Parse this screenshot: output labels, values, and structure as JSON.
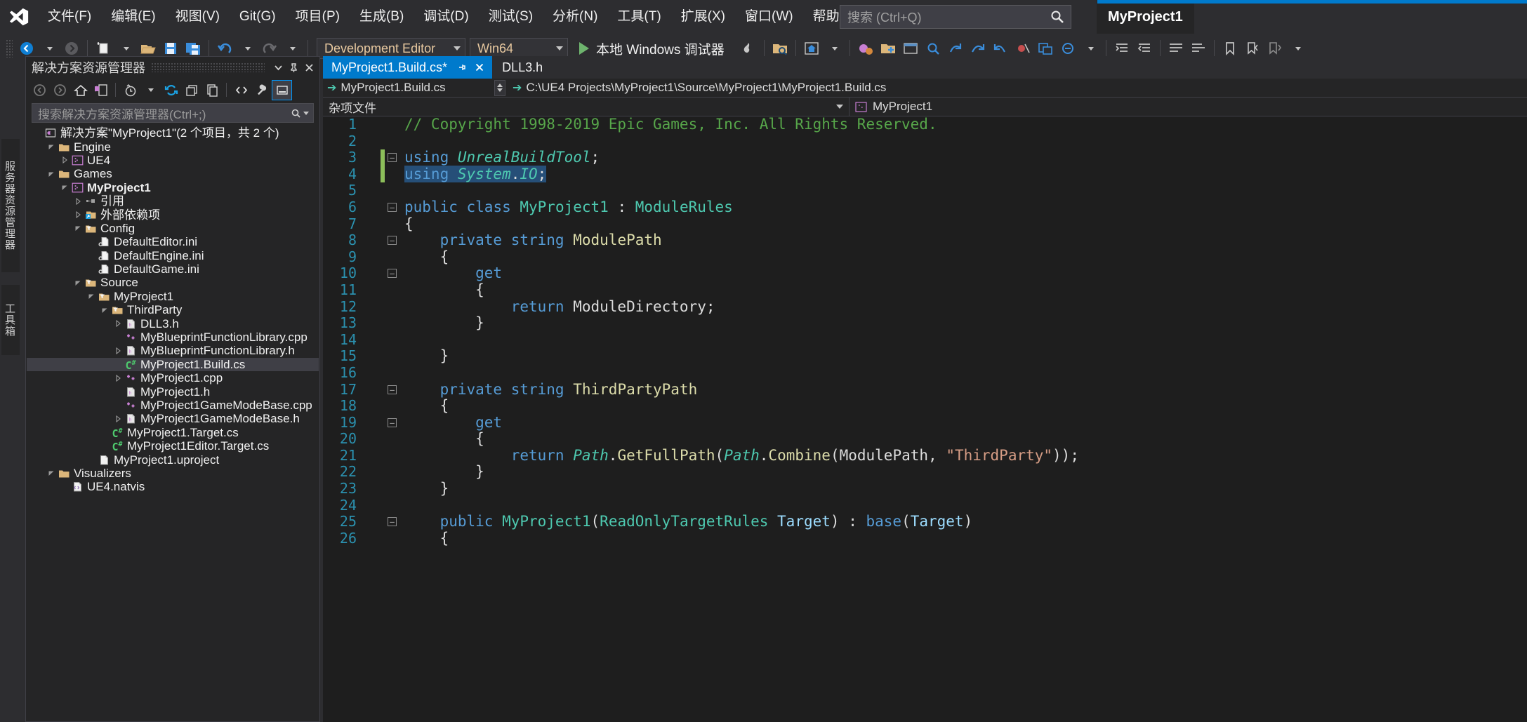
{
  "app": {
    "project_name": "MyProject1",
    "accent_color": "#007acc"
  },
  "menu": {
    "items": [
      {
        "label": "文件(F)"
      },
      {
        "label": "编辑(E)"
      },
      {
        "label": "视图(V)"
      },
      {
        "label": "Git(G)"
      },
      {
        "label": "项目(P)"
      },
      {
        "label": "生成(B)"
      },
      {
        "label": "调试(D)"
      },
      {
        "label": "测试(S)"
      },
      {
        "label": "分析(N)"
      },
      {
        "label": "工具(T)"
      },
      {
        "label": "扩展(X)"
      },
      {
        "label": "窗口(W)"
      },
      {
        "label": "帮助(H)"
      }
    ]
  },
  "search": {
    "placeholder": "搜索 (Ctrl+Q)",
    "icon": "search-icon"
  },
  "toolbar": {
    "configuration": "Development Editor",
    "platform": "Win64",
    "run_label": "本地 Windows 调试器"
  },
  "left_strip": {
    "tabs": [
      {
        "label": "服务器资源管理器"
      },
      {
        "label": "工具箱"
      }
    ]
  },
  "solution_explorer": {
    "title": "解决方案资源管理器",
    "search_placeholder": "搜索解决方案资源管理器(Ctrl+;)",
    "toolbar_icons": [
      "back-icon",
      "forward-icon",
      "home-icon",
      "pending-changes-icon",
      "history-icon",
      "refresh-icon",
      "collapse-all-icon",
      "show-all-files-icon",
      "view-code-icon",
      "properties-icon",
      "preview-selected-icon"
    ],
    "header_icons": [
      "chevron-down-icon",
      "pin-icon",
      "close-icon"
    ],
    "tree": [
      {
        "label": "解决方案\"MyProject1\"(2 个项目，共 2 个)",
        "depth": 0,
        "icon": "solution-icon",
        "chev": "none",
        "bold": false,
        "selected": false
      },
      {
        "label": "Engine",
        "depth": 1,
        "icon": "folder-icon",
        "chev": "expanded",
        "bold": false,
        "selected": false
      },
      {
        "label": "UE4",
        "depth": 2,
        "icon": "cpp-project-icon",
        "chev": "collapsed",
        "bold": false,
        "selected": false
      },
      {
        "label": "Games",
        "depth": 1,
        "icon": "folder-icon",
        "chev": "expanded",
        "bold": false,
        "selected": false
      },
      {
        "label": "MyProject1",
        "depth": 2,
        "icon": "cpp-project-icon",
        "chev": "expanded",
        "bold": true,
        "selected": false
      },
      {
        "label": "引用",
        "depth": 3,
        "icon": "references-icon",
        "chev": "collapsed",
        "bold": false,
        "selected": false
      },
      {
        "label": "外部依赖项",
        "depth": 3,
        "icon": "external-deps-icon",
        "chev": "collapsed",
        "bold": false,
        "selected": false
      },
      {
        "label": "Config",
        "depth": 3,
        "icon": "filter-folder-icon",
        "chev": "expanded",
        "bold": false,
        "selected": false
      },
      {
        "label": "DefaultEditor.ini",
        "depth": 4,
        "icon": "ini-file-icon",
        "chev": "none",
        "bold": false,
        "selected": false
      },
      {
        "label": "DefaultEngine.ini",
        "depth": 4,
        "icon": "ini-file-icon",
        "chev": "none",
        "bold": false,
        "selected": false
      },
      {
        "label": "DefaultGame.ini",
        "depth": 4,
        "icon": "ini-file-icon",
        "chev": "none",
        "bold": false,
        "selected": false
      },
      {
        "label": "Source",
        "depth": 3,
        "icon": "filter-folder-icon",
        "chev": "expanded",
        "bold": false,
        "selected": false
      },
      {
        "label": "MyProject1",
        "depth": 4,
        "icon": "filter-folder-icon",
        "chev": "expanded",
        "bold": false,
        "selected": false
      },
      {
        "label": "ThirdParty",
        "depth": 5,
        "icon": "filter-folder-icon",
        "chev": "expanded",
        "bold": false,
        "selected": false
      },
      {
        "label": "DLL3.h",
        "depth": 6,
        "icon": "header-file-icon",
        "chev": "collapsed",
        "bold": false,
        "selected": false
      },
      {
        "label": "MyBlueprintFunctionLibrary.cpp",
        "depth": 6,
        "icon": "cpp-file-icon",
        "chev": "none",
        "bold": false,
        "selected": false
      },
      {
        "label": "MyBlueprintFunctionLibrary.h",
        "depth": 6,
        "icon": "header-file-icon",
        "chev": "collapsed",
        "bold": false,
        "selected": false
      },
      {
        "label": "MyProject1.Build.cs",
        "depth": 6,
        "icon": "csharp-file-icon",
        "chev": "none",
        "bold": false,
        "selected": true
      },
      {
        "label": "MyProject1.cpp",
        "depth": 6,
        "icon": "cpp-file-icon",
        "chev": "collapsed",
        "bold": false,
        "selected": false
      },
      {
        "label": "MyProject1.h",
        "depth": 6,
        "icon": "header-file-icon",
        "chev": "none",
        "bold": false,
        "selected": false
      },
      {
        "label": "MyProject1GameModeBase.cpp",
        "depth": 6,
        "icon": "cpp-file-icon",
        "chev": "none",
        "bold": false,
        "selected": false
      },
      {
        "label": "MyProject1GameModeBase.h",
        "depth": 6,
        "icon": "header-file-icon",
        "chev": "collapsed",
        "bold": false,
        "selected": false
      },
      {
        "label": "MyProject1.Target.cs",
        "depth": 5,
        "icon": "csharp-file-icon",
        "chev": "none",
        "bold": false,
        "selected": false
      },
      {
        "label": "MyProject1Editor.Target.cs",
        "depth": 5,
        "icon": "csharp-file-icon",
        "chev": "none",
        "bold": false,
        "selected": false
      },
      {
        "label": "MyProject1.uproject",
        "depth": 4,
        "icon": "generic-file-icon",
        "chev": "none",
        "bold": false,
        "selected": false
      },
      {
        "label": "Visualizers",
        "depth": 1,
        "icon": "folder-icon",
        "chev": "expanded",
        "bold": false,
        "selected": false
      },
      {
        "label": "UE4.natvis",
        "depth": 2,
        "icon": "natvis-file-icon",
        "chev": "none",
        "bold": false,
        "selected": false
      }
    ]
  },
  "editor": {
    "tabs": [
      {
        "label": "MyProject1.Build.cs*",
        "active": true,
        "closable": true
      },
      {
        "label": "DLL3.h",
        "active": false,
        "closable": false
      }
    ],
    "nav_left": "MyProject1.Build.cs",
    "nav_right": "C:\\UE4 Projects\\MyProject1\\Source\\MyProject1\\MyProject1.Build.cs",
    "crumb_left": "杂项文件",
    "crumb_right": "MyProject1",
    "first_line_number": 1,
    "lines": [
      {
        "n": 1,
        "fold": "none",
        "change": false,
        "tokens": [
          {
            "t": "// Copyright 1998-2019 Epic Games, Inc. All Rights Reserved.",
            "c": "c-com"
          }
        ]
      },
      {
        "n": 2,
        "fold": "none",
        "change": false,
        "tokens": []
      },
      {
        "n": 3,
        "fold": "minus",
        "change": true,
        "tokens": [
          {
            "t": "using ",
            "c": "c-kw"
          },
          {
            "t": "UnrealBuildTool",
            "c": "c-ns"
          },
          {
            "t": ";",
            "c": "c-pln"
          }
        ]
      },
      {
        "n": 4,
        "fold": "none",
        "change": true,
        "tokens": [
          {
            "t": "using ",
            "c": "c-kw c-sel"
          },
          {
            "t": "System",
            "c": "c-ns c-sel"
          },
          {
            "t": ".",
            "c": "c-pln c-sel"
          },
          {
            "t": "IO",
            "c": "c-ns c-sel"
          },
          {
            "t": ";",
            "c": "c-pln c-sel"
          }
        ]
      },
      {
        "n": 5,
        "fold": "none",
        "change": false,
        "tokens": []
      },
      {
        "n": 6,
        "fold": "minus",
        "change": false,
        "tokens": [
          {
            "t": "public ",
            "c": "c-kw"
          },
          {
            "t": "class ",
            "c": "c-kw"
          },
          {
            "t": "MyProject1",
            "c": "c-typ"
          },
          {
            "t": " : ",
            "c": "c-pln"
          },
          {
            "t": "ModuleRules",
            "c": "c-typ"
          }
        ]
      },
      {
        "n": 7,
        "fold": "none",
        "change": false,
        "tokens": [
          {
            "t": "{",
            "c": "c-pln"
          }
        ]
      },
      {
        "n": 8,
        "fold": "minus",
        "change": false,
        "tokens": [
          {
            "t": "    private ",
            "c": "c-kw"
          },
          {
            "t": "string ",
            "c": "c-kw"
          },
          {
            "t": "ModulePath",
            "c": "c-mem"
          }
        ]
      },
      {
        "n": 9,
        "fold": "none",
        "change": false,
        "tokens": [
          {
            "t": "    {",
            "c": "c-pln"
          }
        ]
      },
      {
        "n": 10,
        "fold": "minus",
        "change": false,
        "tokens": [
          {
            "t": "        get",
            "c": "c-kw"
          }
        ]
      },
      {
        "n": 11,
        "fold": "none",
        "change": false,
        "tokens": [
          {
            "t": "        {",
            "c": "c-pln"
          }
        ]
      },
      {
        "n": 12,
        "fold": "none",
        "change": false,
        "tokens": [
          {
            "t": "            return ",
            "c": "c-kw"
          },
          {
            "t": "ModuleDirectory",
            "c": "c-pln"
          },
          {
            "t": ";",
            "c": "c-pln"
          }
        ]
      },
      {
        "n": 13,
        "fold": "none",
        "change": false,
        "tokens": [
          {
            "t": "        }",
            "c": "c-pln"
          }
        ]
      },
      {
        "n": 14,
        "fold": "none",
        "change": false,
        "tokens": []
      },
      {
        "n": 15,
        "fold": "none",
        "change": false,
        "tokens": [
          {
            "t": "    }",
            "c": "c-pln"
          }
        ]
      },
      {
        "n": 16,
        "fold": "none",
        "change": false,
        "tokens": []
      },
      {
        "n": 17,
        "fold": "minus",
        "change": false,
        "tokens": [
          {
            "t": "    private ",
            "c": "c-kw"
          },
          {
            "t": "string ",
            "c": "c-kw"
          },
          {
            "t": "ThirdPartyPath",
            "c": "c-mem"
          }
        ]
      },
      {
        "n": 18,
        "fold": "none",
        "change": false,
        "tokens": [
          {
            "t": "    {",
            "c": "c-pln"
          }
        ]
      },
      {
        "n": 19,
        "fold": "minus",
        "change": false,
        "tokens": [
          {
            "t": "        get",
            "c": "c-kw"
          }
        ]
      },
      {
        "n": 20,
        "fold": "none",
        "change": false,
        "tokens": [
          {
            "t": "        {",
            "c": "c-pln"
          }
        ]
      },
      {
        "n": 21,
        "fold": "none",
        "change": false,
        "tokens": [
          {
            "t": "            return ",
            "c": "c-kw"
          },
          {
            "t": "Path",
            "c": "c-ns"
          },
          {
            "t": ".",
            "c": "c-pln"
          },
          {
            "t": "GetFullPath",
            "c": "c-mem"
          },
          {
            "t": "(",
            "c": "c-pln"
          },
          {
            "t": "Path",
            "c": "c-ns"
          },
          {
            "t": ".",
            "c": "c-pln"
          },
          {
            "t": "Combine",
            "c": "c-mem"
          },
          {
            "t": "(ModulePath, ",
            "c": "c-pln"
          },
          {
            "t": "\"ThirdParty\"",
            "c": "c-str"
          },
          {
            "t": "));",
            "c": "c-pln"
          }
        ]
      },
      {
        "n": 22,
        "fold": "none",
        "change": false,
        "tokens": [
          {
            "t": "        }",
            "c": "c-pln"
          }
        ]
      },
      {
        "n": 23,
        "fold": "none",
        "change": false,
        "tokens": [
          {
            "t": "    }",
            "c": "c-pln"
          }
        ]
      },
      {
        "n": 24,
        "fold": "none",
        "change": false,
        "tokens": []
      },
      {
        "n": 25,
        "fold": "minus",
        "change": false,
        "tokens": [
          {
            "t": "    public ",
            "c": "c-kw"
          },
          {
            "t": "MyProject1",
            "c": "c-typ"
          },
          {
            "t": "(",
            "c": "c-pln"
          },
          {
            "t": "ReadOnlyTargetRules",
            "c": "c-typ"
          },
          {
            "t": " Target",
            "c": "c-par"
          },
          {
            "t": ") : ",
            "c": "c-pln"
          },
          {
            "t": "base",
            "c": "c-kw"
          },
          {
            "t": "(",
            "c": "c-pln"
          },
          {
            "t": "Target",
            "c": "c-par"
          },
          {
            "t": ")",
            "c": "c-pln"
          }
        ]
      },
      {
        "n": 26,
        "fold": "none",
        "change": false,
        "tokens": [
          {
            "t": "    {",
            "c": "c-pln"
          }
        ]
      }
    ]
  }
}
